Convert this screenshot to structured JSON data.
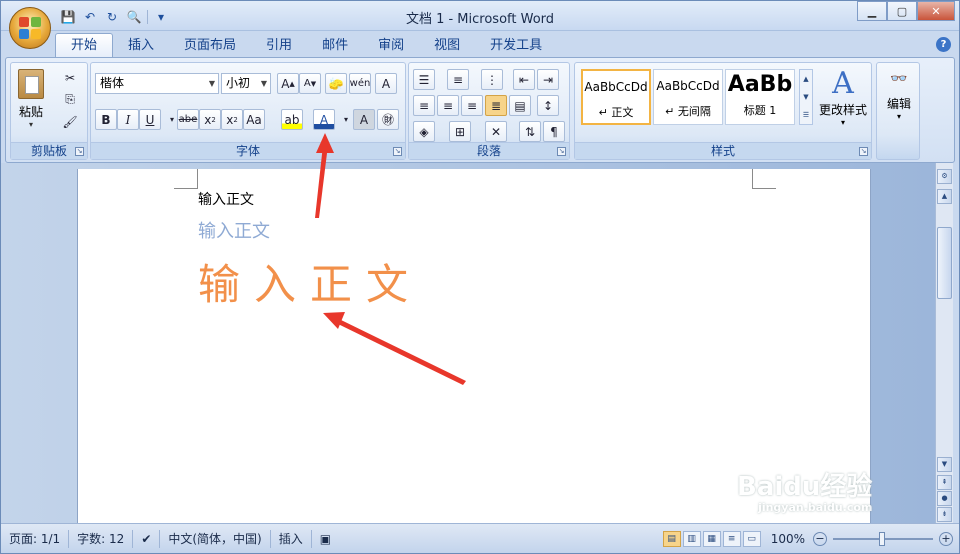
{
  "window": {
    "title": "文档 1 - Microsoft Word"
  },
  "qat": {
    "save": "💾",
    "undo": "↶",
    "redo": "↻",
    "preview": "🔍",
    "more": "▾"
  },
  "tabs": [
    "开始",
    "插入",
    "页面布局",
    "引用",
    "邮件",
    "审阅",
    "视图",
    "开发工具"
  ],
  "ribbon": {
    "clipboard": {
      "label": "剪贴板",
      "paste": "粘贴"
    },
    "font": {
      "label": "字体",
      "font_name": "楷体",
      "font_size": "小初"
    },
    "paragraph": {
      "label": "段落"
    },
    "styles": {
      "label": "样式",
      "cards": [
        {
          "sample": "AaBbCcDd",
          "name": "↵ 正文"
        },
        {
          "sample": "AaBbCcDd",
          "name": "↵ 无间隔"
        },
        {
          "sample": "AaBb",
          "name": "标题 1"
        }
      ],
      "change_styles": "更改样式"
    },
    "editing": {
      "label": "编辑"
    }
  },
  "document": {
    "lines": [
      "输入正文",
      "输入正文",
      "输入正文"
    ]
  },
  "status": {
    "page": "页面: 1/1",
    "words": "字数: 12",
    "language": "中文(简体，中国)",
    "mode": "插入",
    "zoom": "100%"
  },
  "watermark": {
    "text": "Baidu经验",
    "sub": "jingyan.baidu.com"
  },
  "colors": {
    "font_orange": "#f2904a",
    "font_lightblue": "#8faad4",
    "arrow_red": "#e8372b"
  }
}
